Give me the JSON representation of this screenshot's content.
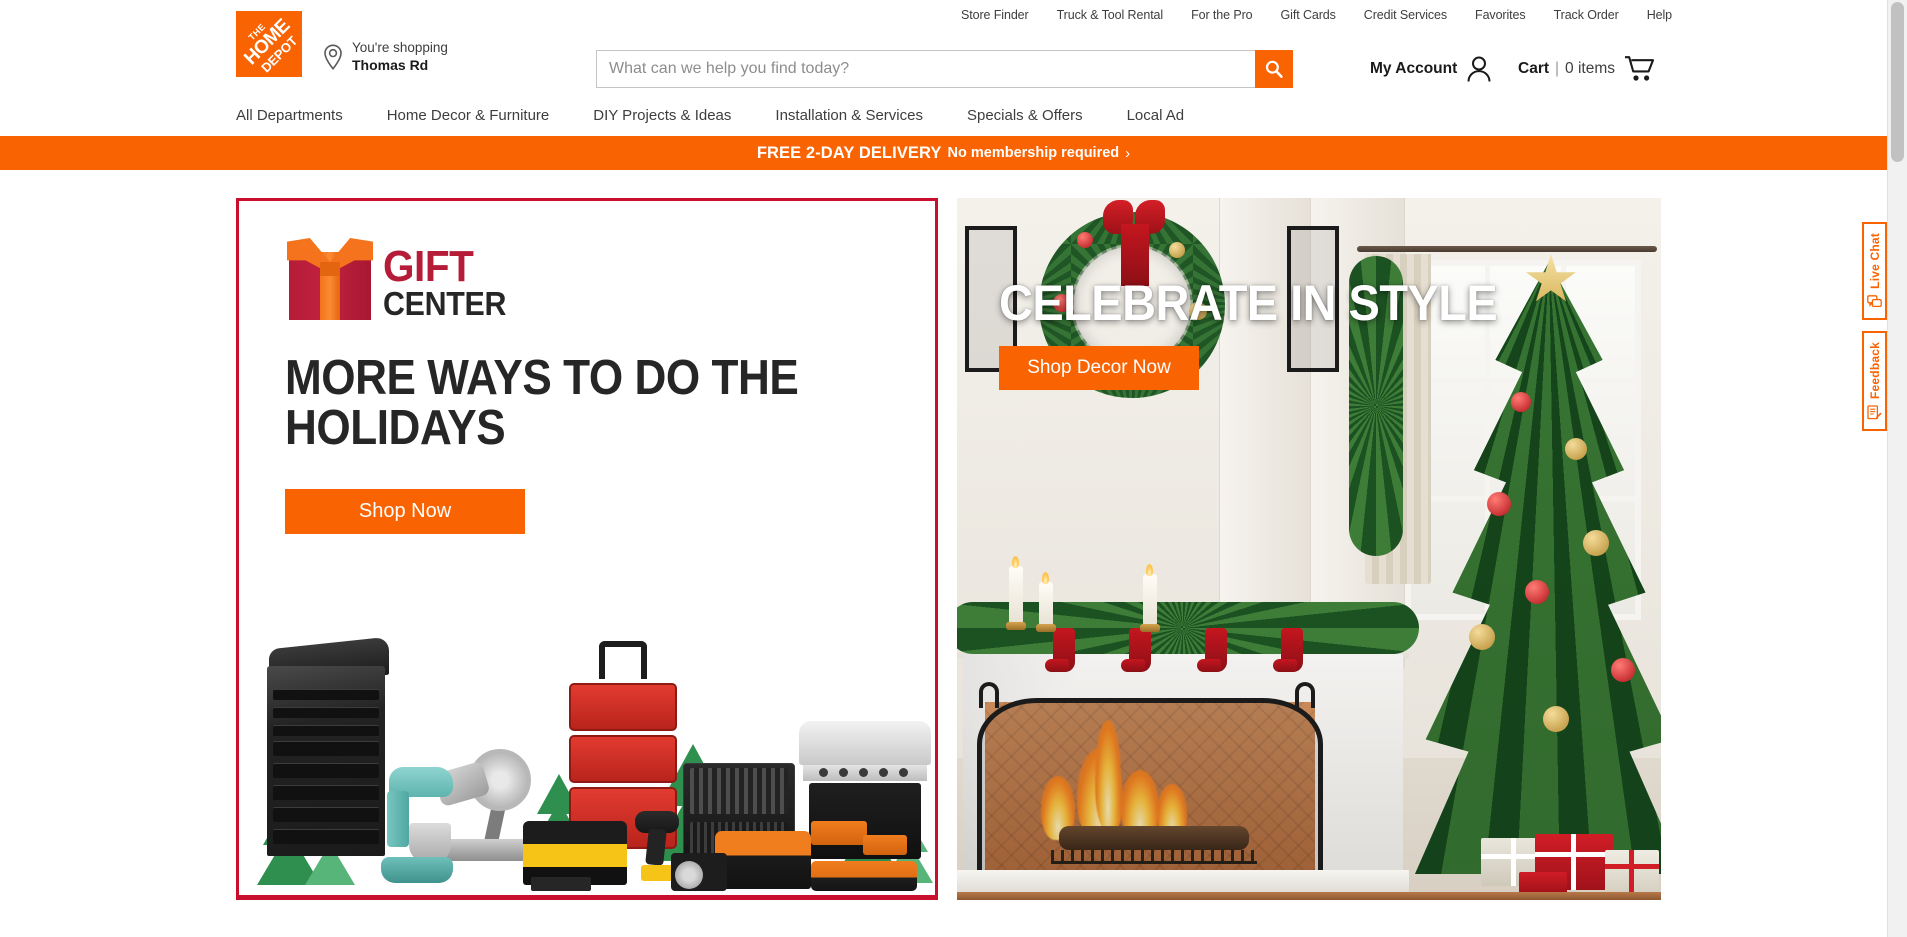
{
  "utility_nav": {
    "links": [
      {
        "label": "Store Finder",
        "icon": "store-finder-icon"
      },
      {
        "label": "Truck & Tool Rental",
        "icon": "truck-rental-icon"
      },
      {
        "label": "For the Pro",
        "icon": "pro-icon"
      },
      {
        "label": "Gift Cards",
        "icon": "gift-card-icon"
      },
      {
        "label": "Credit Services",
        "icon": "credit-icon"
      },
      {
        "label": "Favorites",
        "icon": "favorites-icon"
      },
      {
        "label": "Track Order",
        "icon": "track-order-icon"
      },
      {
        "label": "Help",
        "icon": "help-icon"
      }
    ]
  },
  "header": {
    "logo": {
      "icon": "home-depot-logo",
      "line1": "THE",
      "line2": "HOME",
      "line3": "DEPOT",
      "background": "#f96302"
    },
    "store": {
      "icon": "location-pin-icon",
      "label": "You're shopping",
      "name": "Thomas Rd"
    },
    "search": {
      "placeholder": "What can we help you find today?",
      "value": "",
      "button_icon": "search-icon",
      "button_color": "#f96302"
    },
    "account": {
      "label": "My Account",
      "icon": "user-account-icon"
    },
    "cart": {
      "label": "Cart",
      "separator": "|",
      "count": "0 items",
      "icon": "shopping-cart-icon"
    }
  },
  "primary_nav": {
    "items": [
      {
        "label": "All Departments"
      },
      {
        "label": "Home Decor & Furniture"
      },
      {
        "label": "DIY Projects & Ideas"
      },
      {
        "label": "Installation & Services"
      },
      {
        "label": "Specials & Offers"
      },
      {
        "label": "Local Ad"
      }
    ]
  },
  "delivery_banner": {
    "headline": "FREE 2-DAY DELIVERY",
    "subtext": "No membership required",
    "chevron": "›",
    "background": "#f96302"
  },
  "heroes": {
    "left": {
      "name": "gift-center-promo",
      "border_color": "#c8102e",
      "logo": {
        "icon": "gift-box-icon",
        "word1": "GIFT",
        "word2": "CENTER",
        "word1_color": "#b51c38",
        "word2_color": "#262626"
      },
      "headline": "MORE WAYS TO DO THE HOLIDAYS",
      "cta": {
        "label": "Shop Now",
        "color": "#f96302"
      },
      "imagery": "collage of holiday gift products: black tool chest, teal stand mixer, miter saw, red Milwaukee Packout tool boxes, DeWalt tool bag, mechanics tool set case, gas grill, Ridgid orange power tools, green Christmas trees"
    },
    "right": {
      "name": "celebrate-in-style-promo",
      "headline": "CELEBRATE IN STYLE",
      "cta": {
        "label": "Shop Decor Now",
        "color": "#f96302"
      },
      "imagery": "decorated living room: marble fireplace with lit fire and screen, Christmas wreath with red bow, lit garland with stockings and candles, decorated Christmas tree with gold star topper, wrapped red and white gifts"
    }
  },
  "side_tabs": [
    {
      "label": "Live Chat",
      "icon": "chat-bubble-icon",
      "color": "#f96302"
    },
    {
      "label": "Feedback",
      "icon": "feedback-pencil-icon",
      "color": "#f96302"
    }
  ]
}
